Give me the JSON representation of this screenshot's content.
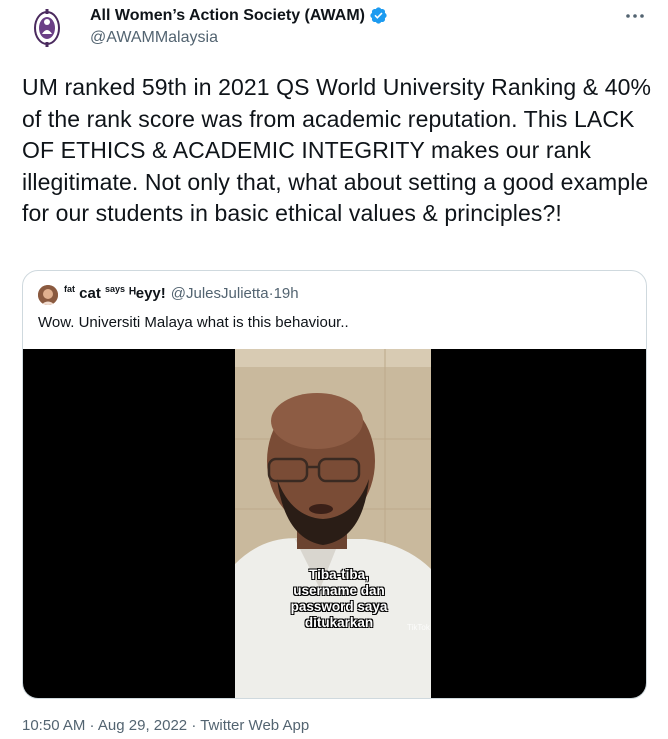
{
  "author": {
    "name": "All Women’s Action Society (AWAM)",
    "handle": "@AWAMMalaysia",
    "verified_color": "#1d9bf0"
  },
  "tweet": {
    "text": "UM ranked 59th in 2021 QS World University Ranking & 40% of the rank score was from academic reputation. This LACK OF ETHICS & ACADEMIC INTEGRITY makes our rank illegitimate. Not only that, what about setting a good example for our students in basic ethical values & principles?!"
  },
  "quote": {
    "name_prefix_sup": "fat",
    "name_cat": " cat ",
    "name_says_sup": "says",
    "name_tail": " ᴴeyy!",
    "handle": "@JulesJulietta",
    "separator": " · ",
    "time": "19h",
    "text": "Wow. Universiti Malaya what is this behaviour..",
    "video_caption": "Tiba-tiba, username dan password saya ditukarkan",
    "watermark": "TikTok"
  },
  "meta": {
    "time": "10:50 AM",
    "date": "Aug 29, 2022",
    "source": "Twitter Web App",
    "separator": " · "
  },
  "icons": {
    "avatar": "awam-logo-icon",
    "verified": "verified-badge-icon",
    "more": "more-horizontal-icon"
  }
}
